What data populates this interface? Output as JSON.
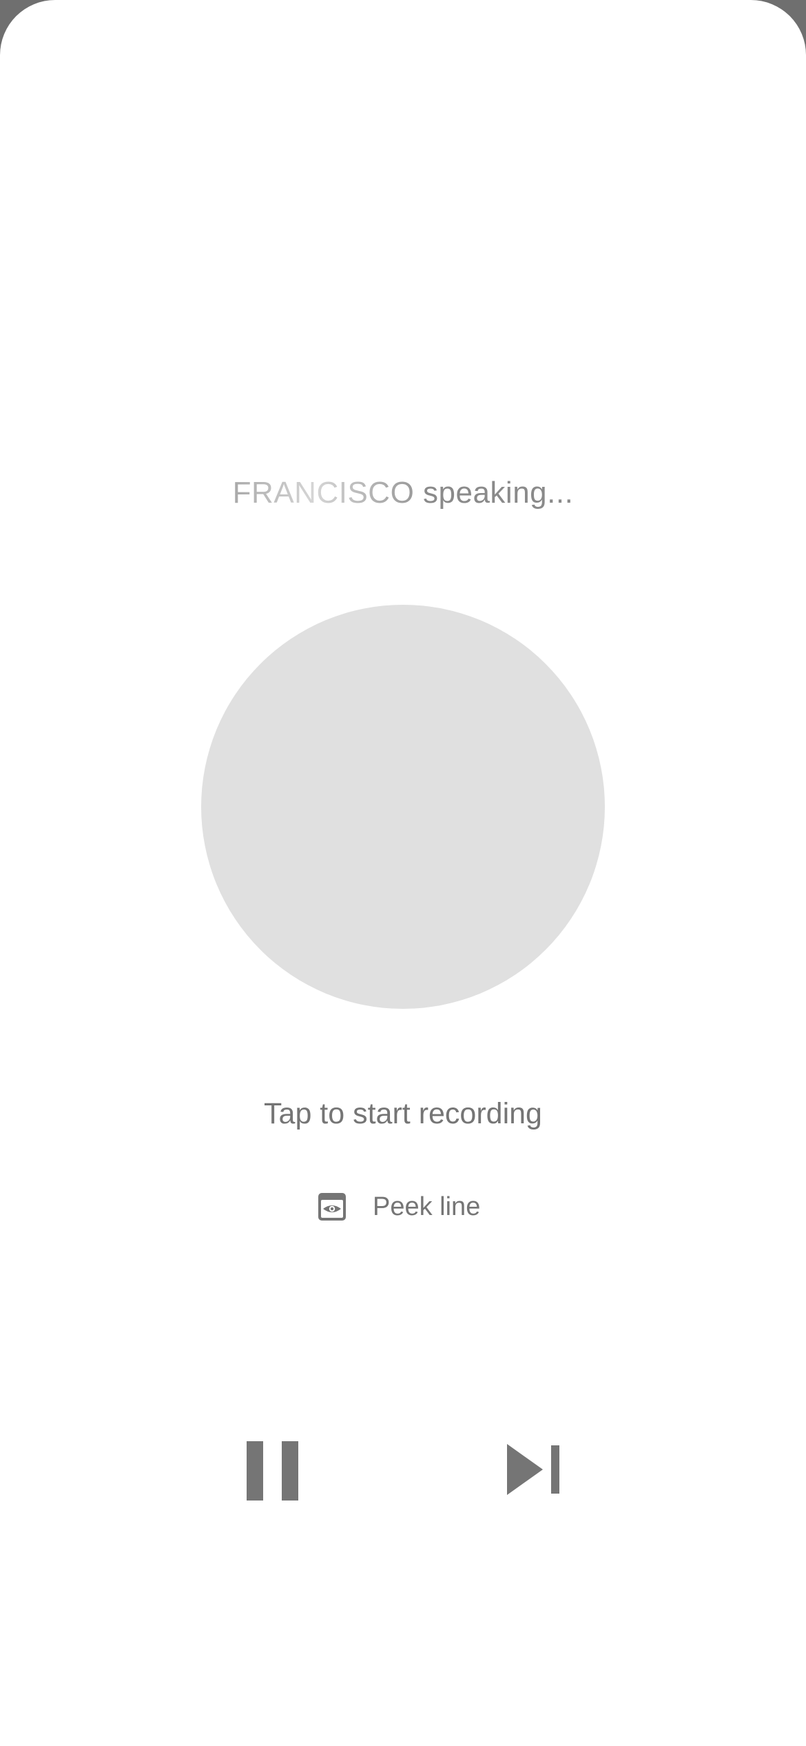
{
  "speaker": {
    "name": "FRANCISCO",
    "suffix": " speaking..."
  },
  "recorder": {
    "hint": "Tap to start recording"
  },
  "peek": {
    "label": "Peek line",
    "icon": "eye-card-icon"
  },
  "controls": {
    "pause_icon": "pause-icon",
    "skip_icon": "skip-next-icon"
  },
  "colors": {
    "background": "#ffffff",
    "record_circle": "#e0e0e0",
    "text": "#757575",
    "icon": "#757575"
  }
}
